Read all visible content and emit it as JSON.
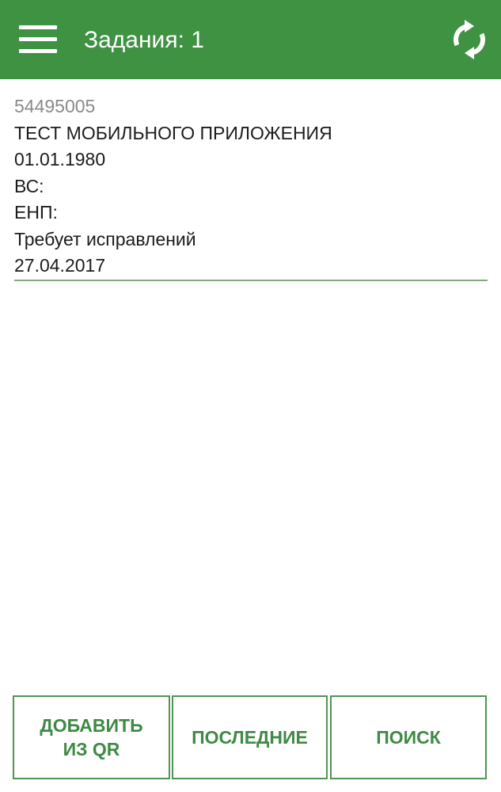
{
  "appbar": {
    "title": "Задания: 1",
    "menu_icon": "hamburger-menu-icon",
    "sync_icon": "sync-icon",
    "color": "#3e9242"
  },
  "task": {
    "id": "54495005",
    "name": "ТЕСТ МОБИЛЬНОГО ПРИЛОЖЕНИЯ",
    "birth_date": "01.01.1980",
    "vs": "ВС:",
    "enp": "ЕНП:",
    "status": "Требует исправлений",
    "date": "27.04.2017"
  },
  "buttons": {
    "add_qr": "ДОБАВИТЬ\nИЗ QR",
    "recent": "ПОСЛЕДНИЕ",
    "search": "ПОИСК",
    "accent": "#3e8a44"
  }
}
